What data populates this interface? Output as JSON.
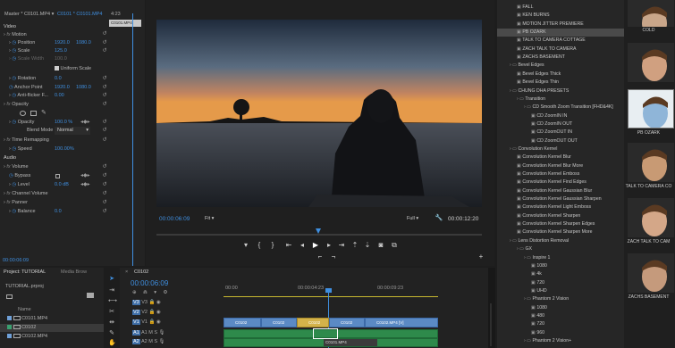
{
  "effect_controls": {
    "header": {
      "source": "Master * C0101.MP4",
      "sequence": "C0101 * C0101.MP4",
      "time": "4:23",
      "clip_label": "C0101.MP4"
    },
    "sections": {
      "video": "Video",
      "audio": "Audio"
    },
    "motion": {
      "label": "Motion",
      "position_label": "Position",
      "position_x": "1920.0",
      "position_y": "1080.0",
      "scale_label": "Scale",
      "scale": "125.0",
      "scale_width_label": "Scale Width",
      "scale_width": "100.0",
      "uniform_scale_label": "Uniform Scale",
      "rotation_label": "Rotation",
      "rotation": "0.0",
      "anchor_label": "Anchor Point",
      "anchor_x": "1920.0",
      "anchor_y": "1080.0",
      "antiflicker_label": "Anti-flicker F...",
      "antiflicker": "0.00"
    },
    "opacity": {
      "label": "Opacity",
      "opacity_label": "Opacity",
      "opacity": "100.0 %",
      "blend_label": "Blend Mode",
      "blend": "Normal"
    },
    "time_remap": {
      "label": "Time Remapping",
      "speed_label": "Speed",
      "speed": "100.00%"
    },
    "volume": {
      "label": "Volume",
      "bypass_label": "Bypass",
      "level_label": "Level",
      "level": "0.0 dB"
    },
    "channel_volume": "Channel Volume",
    "panner": {
      "label": "Panner",
      "balance_label": "Balance",
      "balance": "0.0"
    },
    "footer_time": "00:00:06:09"
  },
  "program_monitor": {
    "timecode": "00:00:06:09",
    "fit": "Fit",
    "quality": "Full",
    "duration": "00:00:12:20"
  },
  "project": {
    "tabs": [
      "Project: TUTORIAL",
      "Media Brow"
    ],
    "file": "TUTORIAL.prproj",
    "name_header": "Name",
    "items": [
      "C0101.MP4",
      "C0102",
      "C0102.MP4"
    ],
    "item_colors": [
      "#6fa0d8",
      "#3aa070",
      "#6fa0d8"
    ]
  },
  "timeline": {
    "tab": "C0102",
    "timecode": "00:00:06:09",
    "ruler": [
      "00:00",
      "00:00:04:23",
      "00:00:09:23"
    ],
    "tracks": [
      "V3",
      "V2",
      "V1",
      "A1",
      "A2",
      "A3"
    ],
    "clips": [
      {
        "label": "C0102"
      },
      {
        "label": "C0102"
      },
      {
        "label": "C0102"
      },
      {
        "label": "C0102"
      },
      {
        "label": "C0102.MP4 [V]"
      }
    ],
    "tooltip": "C0101.MP4"
  },
  "effects": {
    "items": [
      {
        "label": "FALL",
        "level": 2,
        "kind": "preset"
      },
      {
        "label": "KEN BURNS",
        "level": 2,
        "kind": "preset"
      },
      {
        "label": "MOTION JITTER PREMIERE",
        "level": 2,
        "kind": "preset"
      },
      {
        "label": "PB OZARK",
        "level": 2,
        "kind": "preset",
        "selected": true
      },
      {
        "label": "TALK TO CAMERA COTTAGE",
        "level": 2,
        "kind": "preset"
      },
      {
        "label": "ZACH TALK TO CAMERA",
        "level": 2,
        "kind": "preset"
      },
      {
        "label": "ZACHS BASEMENT",
        "level": 2,
        "kind": "preset"
      },
      {
        "label": "Bevel Edges",
        "level": 1,
        "kind": "folder"
      },
      {
        "label": "Bevel Edges Thick",
        "level": 2,
        "kind": "preset"
      },
      {
        "label": "Bevel Edges Thin",
        "level": 2,
        "kind": "preset"
      },
      {
        "label": "CHUNG DHA PRESETS",
        "level": 1,
        "kind": "folder"
      },
      {
        "label": "Transition",
        "level": 2,
        "kind": "folder"
      },
      {
        "label": "CD Smooth Zoom Transition [FHD&4K]",
        "level": 3,
        "kind": "folder"
      },
      {
        "label": "CD ZoomIN IN",
        "level": 4,
        "kind": "preset"
      },
      {
        "label": "CD ZoomIN OUT",
        "level": 4,
        "kind": "preset"
      },
      {
        "label": "CD ZoomOUT IN",
        "level": 4,
        "kind": "preset"
      },
      {
        "label": "CD ZoomOUT OUT",
        "level": 4,
        "kind": "preset"
      },
      {
        "label": "Convolution Kernel",
        "level": 1,
        "kind": "folder"
      },
      {
        "label": "Convolution Kernel Blur",
        "level": 2,
        "kind": "preset"
      },
      {
        "label": "Convolution Kernel Blur More",
        "level": 2,
        "kind": "preset"
      },
      {
        "label": "Convolution Kernel Emboss",
        "level": 2,
        "kind": "preset"
      },
      {
        "label": "Convolution Kernel Find Edges",
        "level": 2,
        "kind": "preset"
      },
      {
        "label": "Convolution Kernel Gaussian Blur",
        "level": 2,
        "kind": "preset"
      },
      {
        "label": "Convolution Kernel Gaussian Sharpen",
        "level": 2,
        "kind": "preset"
      },
      {
        "label": "Convolution Kernel Light Emboss",
        "level": 2,
        "kind": "preset"
      },
      {
        "label": "Convolution Kernel Sharpen",
        "level": 2,
        "kind": "preset"
      },
      {
        "label": "Convolution Kernel Sharpen Edges",
        "level": 2,
        "kind": "preset"
      },
      {
        "label": "Convolution Kernel Sharpen More",
        "level": 2,
        "kind": "preset"
      },
      {
        "label": "Lens Distortion Removal",
        "level": 1,
        "kind": "folder"
      },
      {
        "label": "GX",
        "level": 2,
        "kind": "folder"
      },
      {
        "label": "Inspire 1",
        "level": 3,
        "kind": "folder"
      },
      {
        "label": "1080",
        "level": 4,
        "kind": "preset"
      },
      {
        "label": "4k",
        "level": 4,
        "kind": "preset"
      },
      {
        "label": "720",
        "level": 4,
        "kind": "preset"
      },
      {
        "label": "UHD",
        "level": 4,
        "kind": "preset"
      },
      {
        "label": "Phantom 2 Vision",
        "level": 3,
        "kind": "folder"
      },
      {
        "label": "1080",
        "level": 4,
        "kind": "preset"
      },
      {
        "label": "480",
        "level": 4,
        "kind": "preset"
      },
      {
        "label": "720",
        "level": 4,
        "kind": "preset"
      },
      {
        "label": "960",
        "level": 4,
        "kind": "preset"
      },
      {
        "label": "Phantom 2 Vision+",
        "level": 3,
        "kind": "folder"
      }
    ]
  },
  "preset_thumbs": [
    {
      "label": "COLD"
    },
    {
      "label": ""
    },
    {
      "label": "PB OZARK"
    },
    {
      "label": "TALK TO CAMERA CO"
    },
    {
      "label": "ZACH TALK TO CAM"
    },
    {
      "label": "ZACHS BASEMENT"
    }
  ],
  "colors": {
    "accent": "#3f8fe0",
    "playhead": "#3f8fe0",
    "video_clip": "#5b8ac4",
    "audio_clip": "#2e8a4b"
  }
}
